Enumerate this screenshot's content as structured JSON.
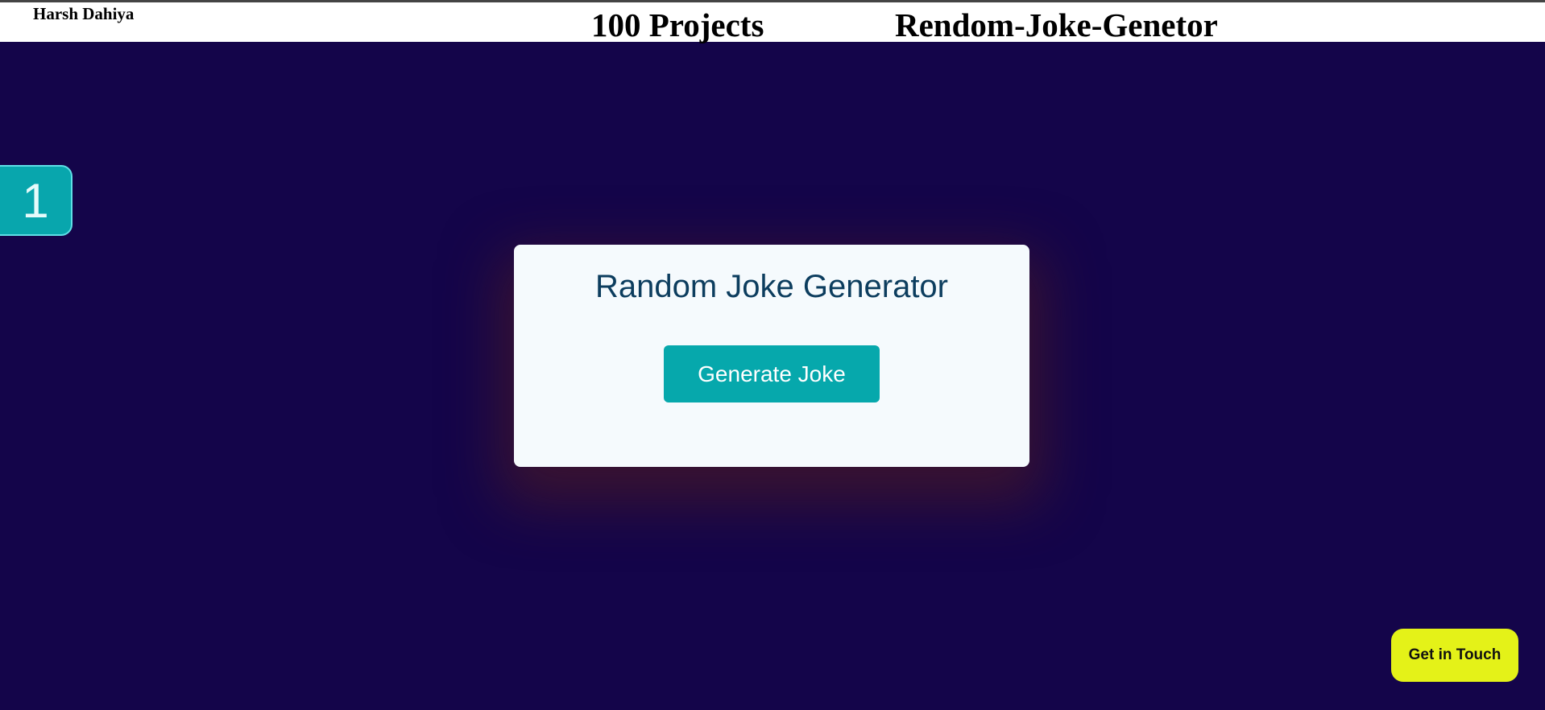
{
  "header": {
    "author": "Harsh Dahiya",
    "series_title": "100 Projects",
    "project_title": "Rendom-Joke-Genetor"
  },
  "badge": {
    "number": "1"
  },
  "card": {
    "title": "Random Joke Generator",
    "button_label": "Generate Joke"
  },
  "contact": {
    "label": "Get in Touch"
  },
  "colors": {
    "background": "#14054a",
    "accent": "#06a8ac",
    "card_background": "#f5fafd",
    "title_text": "#0c3d5e",
    "contact_button": "#e4f218"
  }
}
